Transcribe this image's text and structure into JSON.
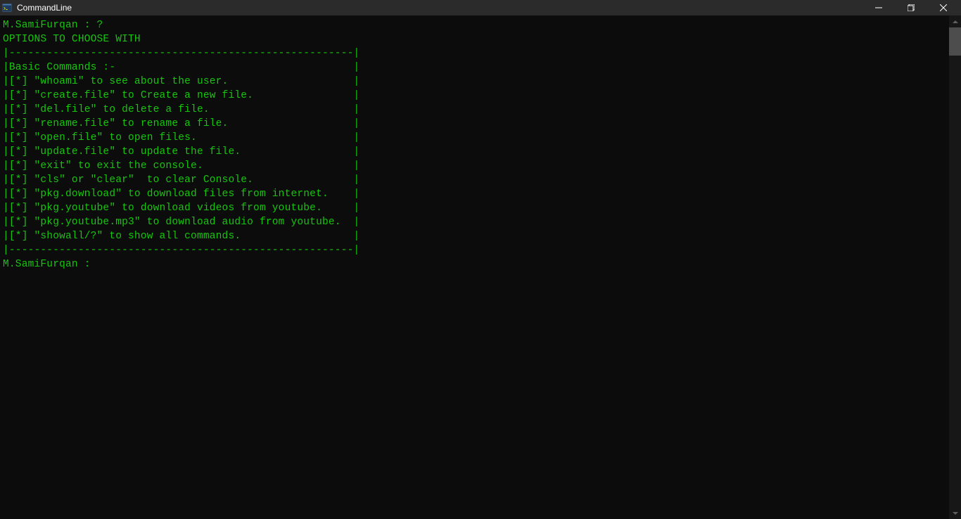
{
  "window": {
    "title": "CommandLine"
  },
  "terminal": {
    "prompt_user": "M.SamiFurqan",
    "first_prompt": "M.SamiFurqan : ?",
    "header": "OPTIONS TO CHOOSE WITH",
    "divider": "|-------------------------------------------------------|",
    "section_title": "|Basic Commands :-                                      |",
    "commands": [
      "|[*] \"whoami\" to see about the user.                    |",
      "|[*] \"create.file\" to Create a new file.                |",
      "|[*] \"del.file\" to delete a file.                       |",
      "|[*] \"rename.file\" to rename a file.                    |",
      "|[*] \"open.file\" to open files.                         |",
      "|[*] \"update.file\" to update the file.                  |",
      "|[*] \"exit\" to exit the console.                        |",
      "|[*] \"cls\" or \"clear\"  to clear Console.                |",
      "|[*] \"pkg.download\" to download files from internet.    |",
      "|[*] \"pkg.youtube\" to download videos from youtube.     |",
      "|[*] \"pkg.youtube.mp3\" to download audio from youtube.  |",
      "|[*] \"showall/?\" to show all commands.                  |"
    ],
    "last_prompt": "M.SamiFurqan : "
  }
}
